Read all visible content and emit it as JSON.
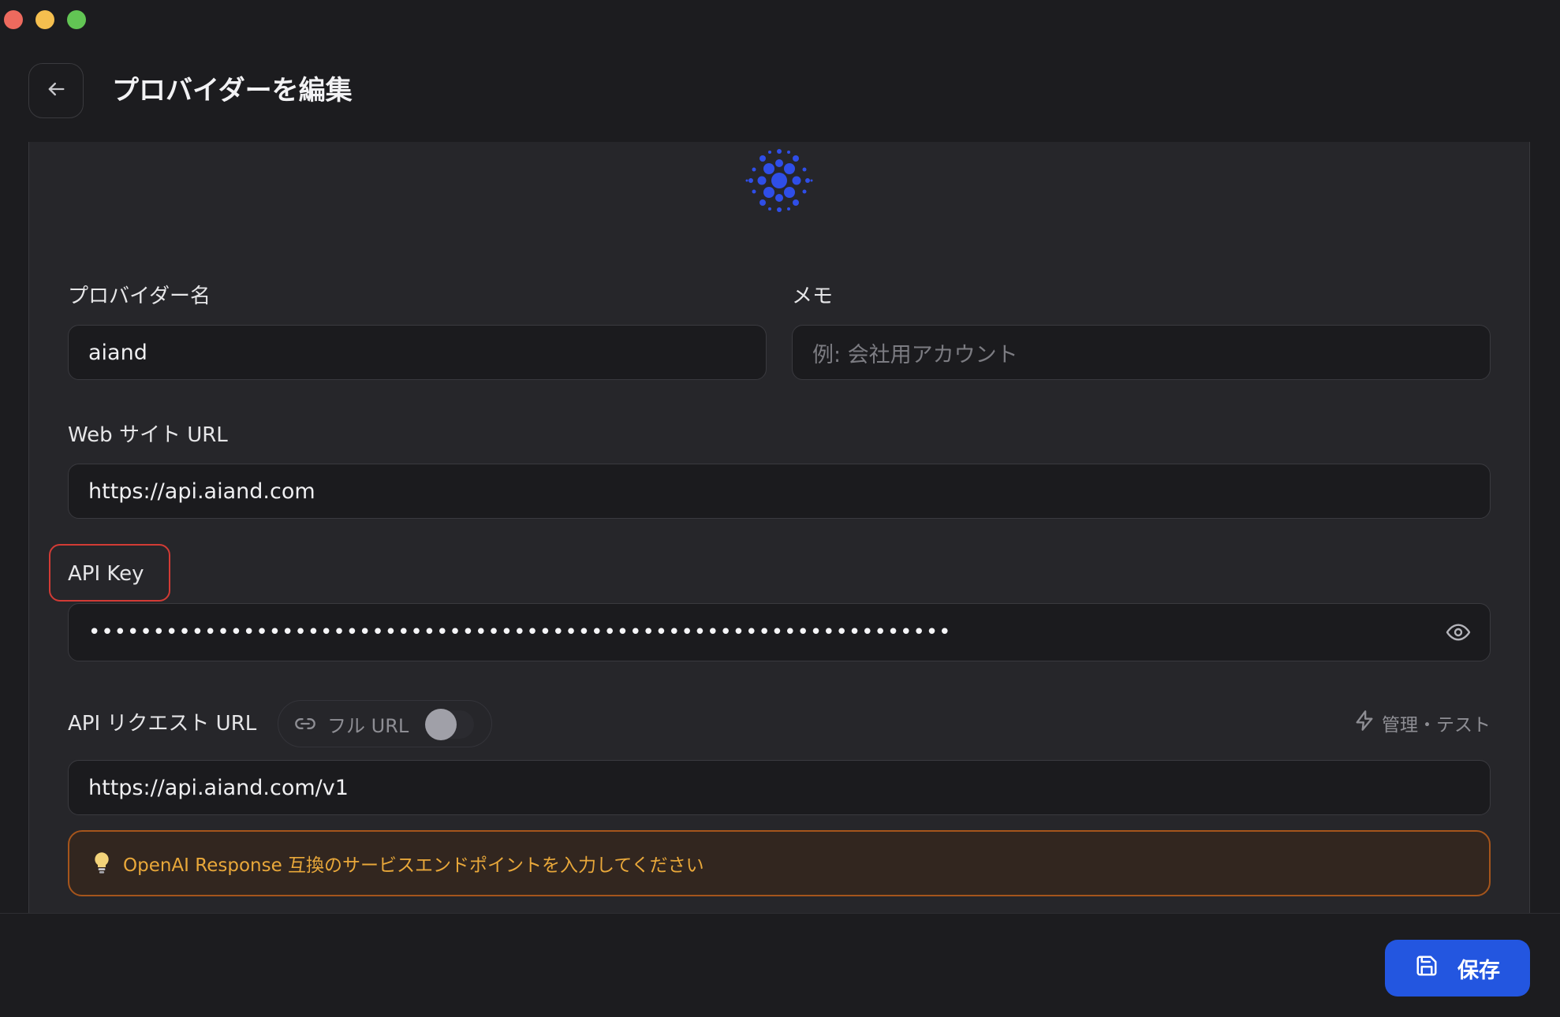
{
  "window": {
    "controls": [
      "close",
      "minimize",
      "maximize"
    ]
  },
  "header": {
    "back_icon": "arrow-left-icon",
    "title": "プロバイダーを編集"
  },
  "logo": {
    "icon": "provider-logo-icon",
    "color": "#2f4ee8"
  },
  "form": {
    "provider_name": {
      "label": "プロバイダー名",
      "value": "aiand"
    },
    "memo": {
      "label": "メモ",
      "placeholder": "例: 会社用アカウント"
    },
    "website_url": {
      "label": "Web サイト URL",
      "value": "https://api.aiand.com"
    },
    "api_key": {
      "label": "API Key",
      "masked_value": "•••••••••••••••••••••••••••••••••••••••••••••••••••••••••••••••••••",
      "reveal_icon": "eye-icon"
    },
    "api_request_url": {
      "label": "API リクエスト URL",
      "full_url_toggle": {
        "label": "フル URL",
        "icon": "link-icon",
        "enabled": false
      },
      "manage_link": {
        "label": "管理・テスト",
        "icon": "lightning-icon"
      },
      "value": "https://api.aiand.com/v1"
    },
    "hint": {
      "icon": "lightbulb-icon",
      "text": "OpenAI Response 互換のサービスエンドポイントを入力してください"
    }
  },
  "footer": {
    "save_button": {
      "label": "保存",
      "icon": "save-icon"
    }
  },
  "colors": {
    "background": "#1c1c1f",
    "panel": "#26262a",
    "accent": "#2356e0",
    "highlight_border": "#d23b35",
    "hint_border": "#a5551c",
    "hint_text": "#e9a83a"
  }
}
